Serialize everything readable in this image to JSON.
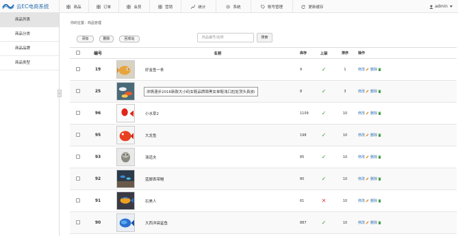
{
  "app": {
    "title": "云EC电商系统"
  },
  "nav": [
    {
      "label": "商品",
      "icon": "grid-icon"
    },
    {
      "label": "订单",
      "icon": "grid-icon"
    },
    {
      "label": "会员",
      "icon": "grid-icon"
    },
    {
      "label": "营销",
      "icon": "grid-icon"
    },
    {
      "label": "统计",
      "icon": "chart-icon"
    },
    {
      "label": "系统",
      "icon": "gear-icon"
    },
    {
      "label": "账号管理",
      "icon": "tag-icon"
    },
    {
      "label": "更新缓存",
      "icon": "refresh-icon"
    }
  ],
  "user": {
    "name": "admin"
  },
  "sidebar": {
    "items": [
      {
        "label": "商品列表",
        "active": true
      },
      {
        "label": "商品分类"
      },
      {
        "label": "商品品牌"
      },
      {
        "label": "商品类型"
      }
    ]
  },
  "breadcrumb": "你的位置：商品管理",
  "toolbar": {
    "add": "添加",
    "delete": "删除",
    "recycle": "回收站"
  },
  "search": {
    "placeholder": "商品编号/名称",
    "button": "搜索"
  },
  "table": {
    "headers": {
      "id": "编号",
      "name": "名称",
      "stock": "库存",
      "onshelf": "上架",
      "sort": "排序",
      "ops": "操作"
    },
    "edit_label": "修改",
    "delete_label": "删除",
    "rows": [
      {
        "id": "19",
        "name": "好金鱼一条",
        "stock": "9",
        "onshelf": true,
        "sort": "1",
        "img": "goldfish"
      },
      {
        "id": "25",
        "name": "浓情漫步2016新款大小码女鞋品牌周黑女单鞋浅口尬尬顶头真皮i",
        "stock": "8",
        "onshelf": true,
        "sort": "3",
        "img": "koi-multi",
        "boxed": true
      },
      {
        "id": "96",
        "name": "小水草2",
        "stock": "1109",
        "onshelf": true,
        "sort": "10",
        "img": "red-white-fish"
      },
      {
        "id": "95",
        "name": "大龙鱼",
        "stock": "198",
        "onshelf": true,
        "sort": "10",
        "img": "red-fish"
      },
      {
        "id": "93",
        "name": "清道夫",
        "stock": "85",
        "onshelf": true,
        "sort": "10",
        "img": "pleco"
      },
      {
        "id": "92",
        "name": "蓝脚表带鳗",
        "stock": "80",
        "onshelf": true,
        "sort": "10",
        "img": "tank"
      },
      {
        "id": "91",
        "name": "石美人",
        "stock": "61",
        "onshelf": false,
        "sort": "10",
        "img": "cichlid"
      },
      {
        "id": "90",
        "name": "大西洋袋鲨鱼",
        "stock": "887",
        "onshelf": true,
        "sort": "10",
        "img": "blue-fish"
      }
    ]
  },
  "colors": {
    "accent": "#2f6fb0",
    "check": "#2a9a2a",
    "cross": "#dd3333",
    "trash": "#3a9a3a",
    "edit": "#e08a1a"
  }
}
